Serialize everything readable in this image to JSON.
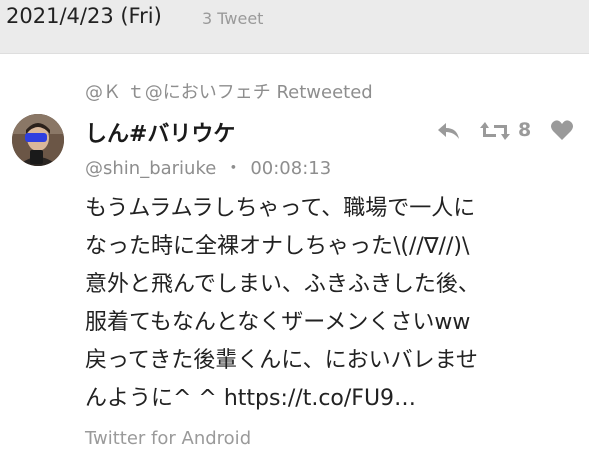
{
  "header": {
    "date": "2021/4/23 (Fri)",
    "tweet_count": "3 Tweet"
  },
  "tweet": {
    "retweeted_by": "@Ｋ ｔ@においフェチ Retweeted",
    "user_name": "しん#バリウケ",
    "handle": "@shin_bariuke",
    "separator": "・",
    "time": "00:08:13",
    "retweet_count": "8",
    "body_lines": [
      "もうムラムラしちゃって、職場で一人に",
      "なった時に全裸オナしちゃった\\(//∇//)\\",
      "意外と飛んでしまい、ふきふきした後、",
      "服着てもなんとなくザーメンくさいww",
      "戻ってきた後輩くんに、においバレませ",
      "んように^ ^ https://t.co/FU9…"
    ],
    "source": "Twitter for Android"
  },
  "icons": {
    "reply": "reply-icon",
    "retweet": "retweet-icon",
    "like": "heart-icon"
  },
  "colors": {
    "header_bg": "#ebebeb",
    "muted_text": "#8e8e8e",
    "icon_gray": "#9a9a9a"
  }
}
